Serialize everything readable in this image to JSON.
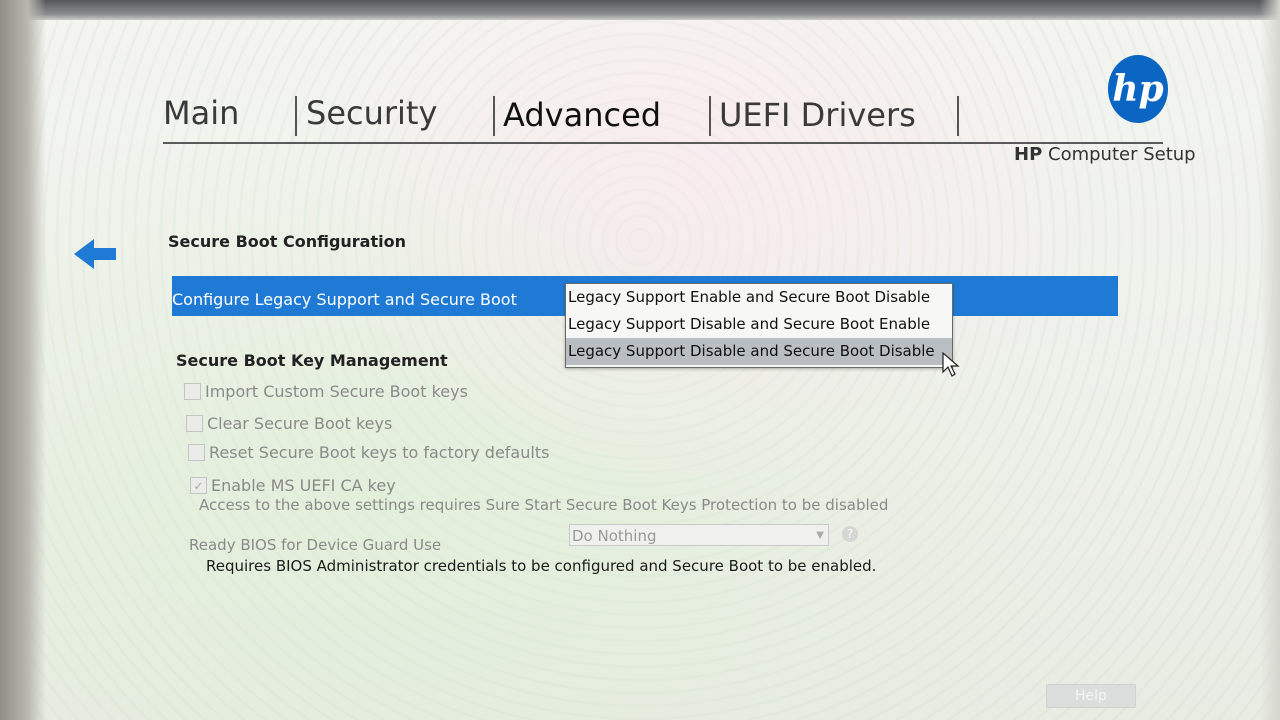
{
  "tabs": [
    {
      "label": "Main"
    },
    {
      "label": "Security"
    },
    {
      "label": "Advanced"
    },
    {
      "label": "UEFI Drivers"
    }
  ],
  "brand": {
    "logo_text": "hp",
    "product_brand": "HP",
    "product_name": "Computer Setup"
  },
  "secure_boot": {
    "section_title": "Secure Boot Configuration",
    "setting_label": "Configure Legacy Support and Secure Boot",
    "options": [
      "Legacy Support Enable and Secure Boot Disable",
      "Legacy Support Disable and Secure Boot Enable",
      "Legacy Support Disable and Secure Boot Disable"
    ]
  },
  "key_management": {
    "section_title": "Secure Boot Key Management",
    "items": [
      {
        "label": "Import Custom Secure Boot keys",
        "checked": false
      },
      {
        "label": "Clear Secure Boot keys",
        "checked": false
      },
      {
        "label": "Reset Secure Boot keys to factory defaults",
        "checked": false
      },
      {
        "label": "Enable MS UEFI CA key",
        "checked": true
      }
    ],
    "access_note": "Access to the above settings requires Sure Start Secure Boot Keys Protection to be disabled"
  },
  "device_guard": {
    "label": "Ready BIOS for Device Guard Use",
    "value": "Do Nothing",
    "help_glyph": "?"
  },
  "requirement_note": "Requires BIOS Administrator credentials to be configured and Secure Boot to be enabled.",
  "footer": {
    "help_label": "Help"
  },
  "colors": {
    "highlight": "#1e7ad4",
    "brand_blue": "#0a66c2"
  }
}
